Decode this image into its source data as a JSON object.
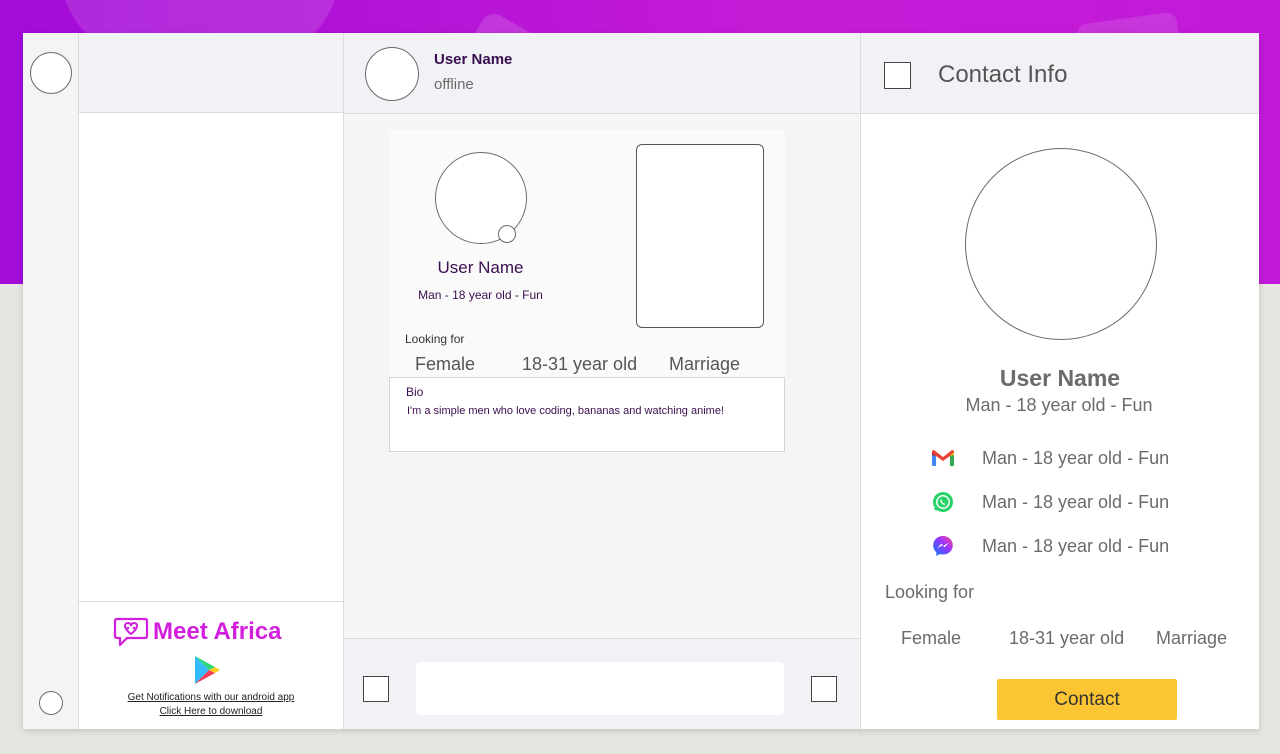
{
  "brand": {
    "name": "Meet Africa",
    "promo_line1": "Get Notifications with our android app",
    "promo_line2": "Click Here to download"
  },
  "chat": {
    "header_name": "User Name",
    "header_status": "offline",
    "composer_placeholder": ""
  },
  "card": {
    "name": "User Name",
    "meta": "Man - 18 year old - Fun",
    "looking_for_label": "Looking for",
    "looking_for": [
      "Female",
      "18-31 year old",
      "Marriage"
    ],
    "bio_label": "Bio",
    "bio_text": "I'm a simple men who love coding, bananas and watching anime!"
  },
  "contact": {
    "title": "Contact Info",
    "name": "User Name",
    "meta": "Man - 18 year old - Fun",
    "socials": [
      {
        "icon": "gmail-icon",
        "text": "Man - 18 year old - Fun"
      },
      {
        "icon": "whatsapp-icon",
        "text": "Man - 18 year old - Fun"
      },
      {
        "icon": "messenger-icon",
        "text": "Man - 18 year old - Fun"
      }
    ],
    "looking_for_label": "Looking for",
    "looking_for": [
      "Female",
      "18-31 year old",
      "Marriage"
    ],
    "button_label": "Contact"
  },
  "colors": {
    "brand": "#d21fdd",
    "accent_button": "#fcc533",
    "background_gradient_start": "#a20bd8",
    "background_gradient_end": "#c01ad8",
    "name_text": "#3a0f4f"
  }
}
